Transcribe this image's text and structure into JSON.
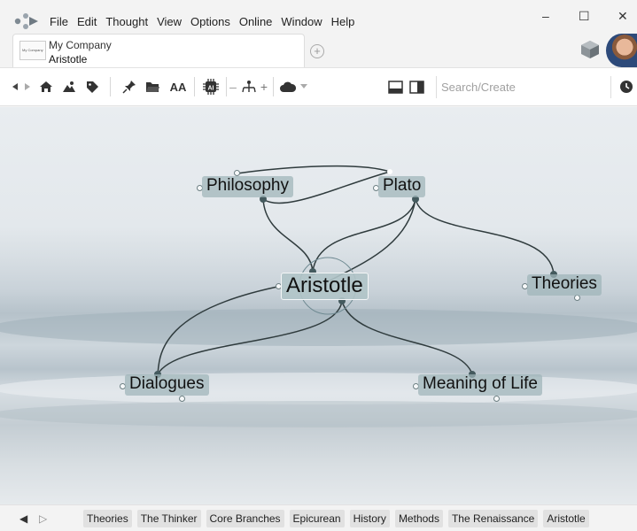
{
  "menu": [
    "File",
    "Edit",
    "Thought",
    "View",
    "Options",
    "Online",
    "Window",
    "Help"
  ],
  "window_controls": {
    "minimize": "–",
    "maximize": "☐",
    "close": "✕"
  },
  "tab": {
    "thumb_text": "My Company",
    "brain_name": "My Company",
    "thought_name": "Aristotle",
    "new_tab_symbol": "+"
  },
  "toolbar": {
    "icons": [
      "back-arrow-icon",
      "forward-arrow-icon",
      "home-icon",
      "view-icon",
      "tag-icon",
      "pin-icon",
      "folder-icon",
      "font-size-icon",
      "ai-chip-icon",
      "layout-minus-icon",
      "layout-icon",
      "layout-plus-icon",
      "cloud-sync-icon",
      "dropdown-icon",
      "split-bottom-icon",
      "split-right-icon",
      "history-clock-icon"
    ],
    "font_label": "AA",
    "ai_label": "AI",
    "minus": "–",
    "plus": "+",
    "search_placeholder": "Search/Create"
  },
  "map": {
    "nodes": {
      "philosophy": "Philosophy",
      "plato": "Plato",
      "aristotle": "Aristotle",
      "theories": "Theories",
      "dialogues": "Dialogues",
      "meaning": "Meaning of Life"
    },
    "active_node": "Aristotle",
    "link_color": "#2f3b3d",
    "node_color": "#9eb4b8"
  },
  "bottom": {
    "nav_back": "◀",
    "nav_forward": "▷",
    "tags": [
      "Theories",
      "The Thinker",
      "Core Branches",
      "Epicurean",
      "History",
      "Methods",
      "The Renaissance",
      "Aristotle"
    ]
  }
}
